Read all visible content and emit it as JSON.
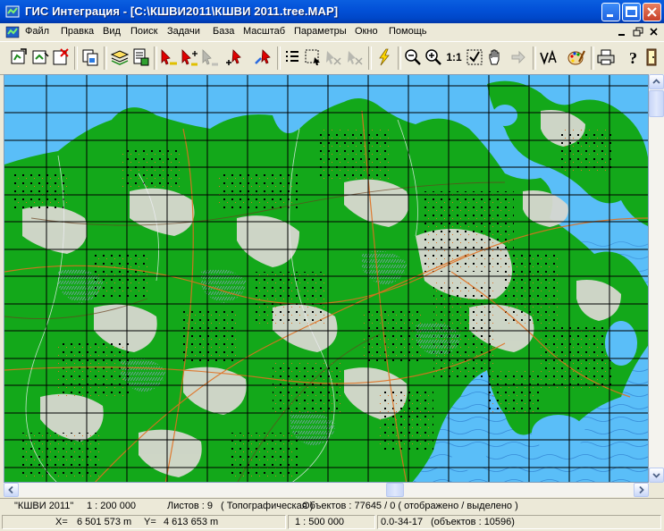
{
  "window": {
    "title": "ГИС Интеграция - [C:\\КШВИ2011\\КШВИ 2011.tree.MAP]"
  },
  "menu": {
    "items": [
      "Файл",
      "Правка",
      "Вид",
      "Поиск",
      "Задачи",
      "База",
      "Масштаб",
      "Параметры",
      "Окно",
      "Помощь"
    ]
  },
  "toolbar": {
    "buttons": [
      "open-map-icon",
      "save-map-icon",
      "close-map-icon",
      "copy-icon",
      "layers-icon",
      "document-icon",
      "select-object-icon",
      "select-add-icon",
      "select-disabled-icon",
      "create-object-icon",
      "edit-object-icon",
      "list-icon",
      "select-region-icon",
      "measure-disabled-icon",
      "delete-disabled-icon",
      "lightning-icon",
      "zoom-out-icon",
      "zoom-in-icon",
      "scale-1-1-icon",
      "checkmark-icon",
      "hand-pan-icon",
      "arrow-disabled-icon",
      "text-icon",
      "palette-icon",
      "print-icon",
      "help-icon",
      "exit-icon"
    ],
    "scale_label": "1:1"
  },
  "status": {
    "map_name": "\"КШВИ 2011\"",
    "scale": "1 : 200 000",
    "sheets": "Листов : 9",
    "map_type": "( Топографическая )",
    "objects": "Объектов : 77645 / 0 ( отображено / выделено )",
    "x_label": "X=",
    "x_value": "6 501 573 m",
    "y_label": "Y=",
    "y_value": "4 613 653 m",
    "view_scale": "1 : 500 000",
    "sheet_nomenclature": "0.0-34-17",
    "sheet_objects": "(объектов : 10596)"
  },
  "colors": {
    "title_bar": "#0351D8",
    "map_water": "#5ABEF8",
    "map_forest": "#13A81A",
    "map_land": "#D8D8D0",
    "map_grid": "#000000"
  }
}
